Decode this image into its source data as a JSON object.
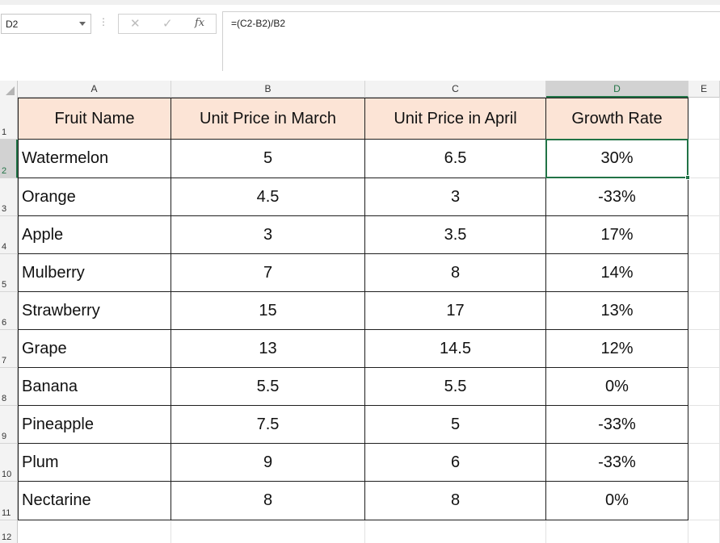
{
  "name_box": {
    "value": "D2"
  },
  "formula_bar": {
    "formula": "=(C2-B2)/B2"
  },
  "columns": [
    "A",
    "B",
    "C",
    "D",
    "E"
  ],
  "rows": [
    "1",
    "2",
    "3",
    "4",
    "5",
    "6",
    "7",
    "8",
    "9",
    "10",
    "11",
    "12"
  ],
  "active_cell": "D2",
  "header_fill_color": "#fce4d6",
  "selection_color": "#217346",
  "table": {
    "headers": [
      "Fruit Name",
      "Unit Price in March",
      "Unit Price in April",
      "Growth Rate"
    ],
    "rows": [
      [
        "Watermelon",
        "5",
        "6.5",
        "30%"
      ],
      [
        "Orange",
        "4.5",
        "3",
        "-33%"
      ],
      [
        "Apple",
        "3",
        "3.5",
        "17%"
      ],
      [
        "Mulberry",
        "7",
        "8",
        "14%"
      ],
      [
        "Strawberry",
        "15",
        "17",
        "13%"
      ],
      [
        "Grape",
        "13",
        "14.5",
        "12%"
      ],
      [
        "Banana",
        "5.5",
        "5.5",
        "0%"
      ],
      [
        "Pineapple",
        "7.5",
        "5",
        "-33%"
      ],
      [
        "Plum",
        "9",
        "6",
        "-33%"
      ],
      [
        "Nectarine",
        "8",
        "8",
        "0%"
      ]
    ]
  }
}
